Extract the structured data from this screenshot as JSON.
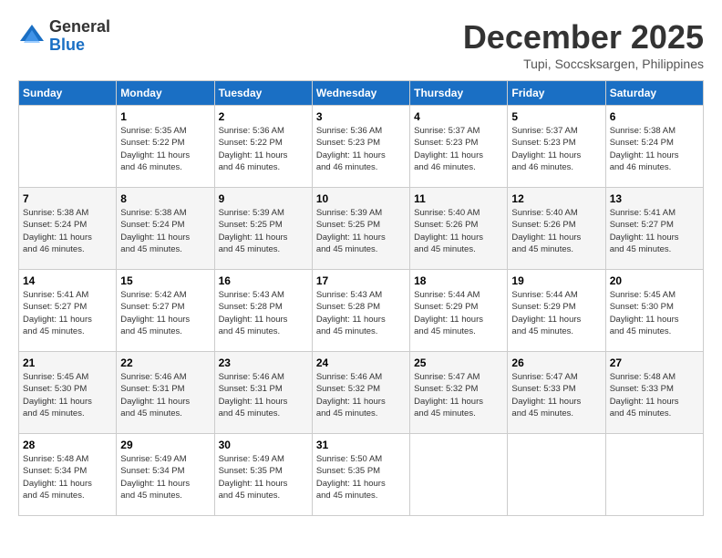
{
  "header": {
    "logo_general": "General",
    "logo_blue": "Blue",
    "month_title": "December 2025",
    "location": "Tupi, Soccsksargen, Philippines"
  },
  "calendar": {
    "days_of_week": [
      "Sunday",
      "Monday",
      "Tuesday",
      "Wednesday",
      "Thursday",
      "Friday",
      "Saturday"
    ],
    "weeks": [
      [
        {
          "day": "",
          "info": ""
        },
        {
          "day": "1",
          "info": "Sunrise: 5:35 AM\nSunset: 5:22 PM\nDaylight: 11 hours\nand 46 minutes."
        },
        {
          "day": "2",
          "info": "Sunrise: 5:36 AM\nSunset: 5:22 PM\nDaylight: 11 hours\nand 46 minutes."
        },
        {
          "day": "3",
          "info": "Sunrise: 5:36 AM\nSunset: 5:23 PM\nDaylight: 11 hours\nand 46 minutes."
        },
        {
          "day": "4",
          "info": "Sunrise: 5:37 AM\nSunset: 5:23 PM\nDaylight: 11 hours\nand 46 minutes."
        },
        {
          "day": "5",
          "info": "Sunrise: 5:37 AM\nSunset: 5:23 PM\nDaylight: 11 hours\nand 46 minutes."
        },
        {
          "day": "6",
          "info": "Sunrise: 5:38 AM\nSunset: 5:24 PM\nDaylight: 11 hours\nand 46 minutes."
        }
      ],
      [
        {
          "day": "7",
          "info": "Sunrise: 5:38 AM\nSunset: 5:24 PM\nDaylight: 11 hours\nand 46 minutes."
        },
        {
          "day": "8",
          "info": "Sunrise: 5:38 AM\nSunset: 5:24 PM\nDaylight: 11 hours\nand 45 minutes."
        },
        {
          "day": "9",
          "info": "Sunrise: 5:39 AM\nSunset: 5:25 PM\nDaylight: 11 hours\nand 45 minutes."
        },
        {
          "day": "10",
          "info": "Sunrise: 5:39 AM\nSunset: 5:25 PM\nDaylight: 11 hours\nand 45 minutes."
        },
        {
          "day": "11",
          "info": "Sunrise: 5:40 AM\nSunset: 5:26 PM\nDaylight: 11 hours\nand 45 minutes."
        },
        {
          "day": "12",
          "info": "Sunrise: 5:40 AM\nSunset: 5:26 PM\nDaylight: 11 hours\nand 45 minutes."
        },
        {
          "day": "13",
          "info": "Sunrise: 5:41 AM\nSunset: 5:27 PM\nDaylight: 11 hours\nand 45 minutes."
        }
      ],
      [
        {
          "day": "14",
          "info": "Sunrise: 5:41 AM\nSunset: 5:27 PM\nDaylight: 11 hours\nand 45 minutes."
        },
        {
          "day": "15",
          "info": "Sunrise: 5:42 AM\nSunset: 5:27 PM\nDaylight: 11 hours\nand 45 minutes."
        },
        {
          "day": "16",
          "info": "Sunrise: 5:43 AM\nSunset: 5:28 PM\nDaylight: 11 hours\nand 45 minutes."
        },
        {
          "day": "17",
          "info": "Sunrise: 5:43 AM\nSunset: 5:28 PM\nDaylight: 11 hours\nand 45 minutes."
        },
        {
          "day": "18",
          "info": "Sunrise: 5:44 AM\nSunset: 5:29 PM\nDaylight: 11 hours\nand 45 minutes."
        },
        {
          "day": "19",
          "info": "Sunrise: 5:44 AM\nSunset: 5:29 PM\nDaylight: 11 hours\nand 45 minutes."
        },
        {
          "day": "20",
          "info": "Sunrise: 5:45 AM\nSunset: 5:30 PM\nDaylight: 11 hours\nand 45 minutes."
        }
      ],
      [
        {
          "day": "21",
          "info": "Sunrise: 5:45 AM\nSunset: 5:30 PM\nDaylight: 11 hours\nand 45 minutes."
        },
        {
          "day": "22",
          "info": "Sunrise: 5:46 AM\nSunset: 5:31 PM\nDaylight: 11 hours\nand 45 minutes."
        },
        {
          "day": "23",
          "info": "Sunrise: 5:46 AM\nSunset: 5:31 PM\nDaylight: 11 hours\nand 45 minutes."
        },
        {
          "day": "24",
          "info": "Sunrise: 5:46 AM\nSunset: 5:32 PM\nDaylight: 11 hours\nand 45 minutes."
        },
        {
          "day": "25",
          "info": "Sunrise: 5:47 AM\nSunset: 5:32 PM\nDaylight: 11 hours\nand 45 minutes."
        },
        {
          "day": "26",
          "info": "Sunrise: 5:47 AM\nSunset: 5:33 PM\nDaylight: 11 hours\nand 45 minutes."
        },
        {
          "day": "27",
          "info": "Sunrise: 5:48 AM\nSunset: 5:33 PM\nDaylight: 11 hours\nand 45 minutes."
        }
      ],
      [
        {
          "day": "28",
          "info": "Sunrise: 5:48 AM\nSunset: 5:34 PM\nDaylight: 11 hours\nand 45 minutes."
        },
        {
          "day": "29",
          "info": "Sunrise: 5:49 AM\nSunset: 5:34 PM\nDaylight: 11 hours\nand 45 minutes."
        },
        {
          "day": "30",
          "info": "Sunrise: 5:49 AM\nSunset: 5:35 PM\nDaylight: 11 hours\nand 45 minutes."
        },
        {
          "day": "31",
          "info": "Sunrise: 5:50 AM\nSunset: 5:35 PM\nDaylight: 11 hours\nand 45 minutes."
        },
        {
          "day": "",
          "info": ""
        },
        {
          "day": "",
          "info": ""
        },
        {
          "day": "",
          "info": ""
        }
      ]
    ]
  }
}
